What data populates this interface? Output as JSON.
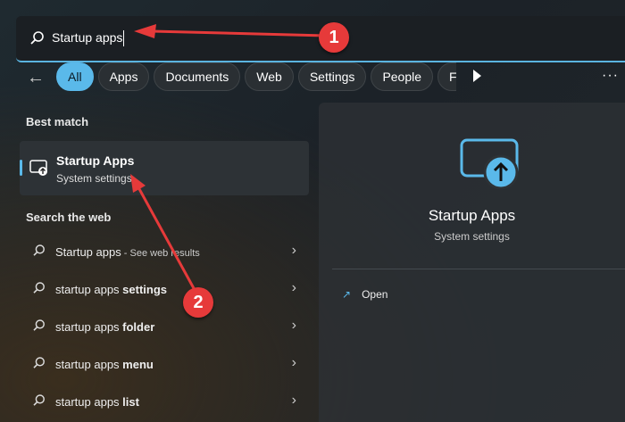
{
  "search": {
    "value": "Startup apps"
  },
  "filters": [
    {
      "label": "All",
      "active": true
    },
    {
      "label": "Apps"
    },
    {
      "label": "Documents"
    },
    {
      "label": "Web"
    },
    {
      "label": "Settings"
    },
    {
      "label": "People"
    },
    {
      "label": "Folders"
    }
  ],
  "best_match": {
    "heading": "Best match",
    "title": "Startup Apps",
    "subtitle": "System settings"
  },
  "web": {
    "heading": "Search the web",
    "items": [
      {
        "prefix": "Startup apps",
        "bold": "",
        "suffix": " - See web results"
      },
      {
        "prefix": "startup apps ",
        "bold": "settings",
        "suffix": ""
      },
      {
        "prefix": "startup apps ",
        "bold": "folder",
        "suffix": ""
      },
      {
        "prefix": "startup apps ",
        "bold": "menu",
        "suffix": ""
      },
      {
        "prefix": "startup apps ",
        "bold": "list",
        "suffix": ""
      }
    ]
  },
  "detail": {
    "title": "Startup Apps",
    "subtitle": "System settings",
    "open_label": "Open"
  },
  "annotations": {
    "one": "1",
    "two": "2"
  },
  "colors": {
    "accent": "#5ab9ea",
    "annotation": "#e63a3a"
  }
}
